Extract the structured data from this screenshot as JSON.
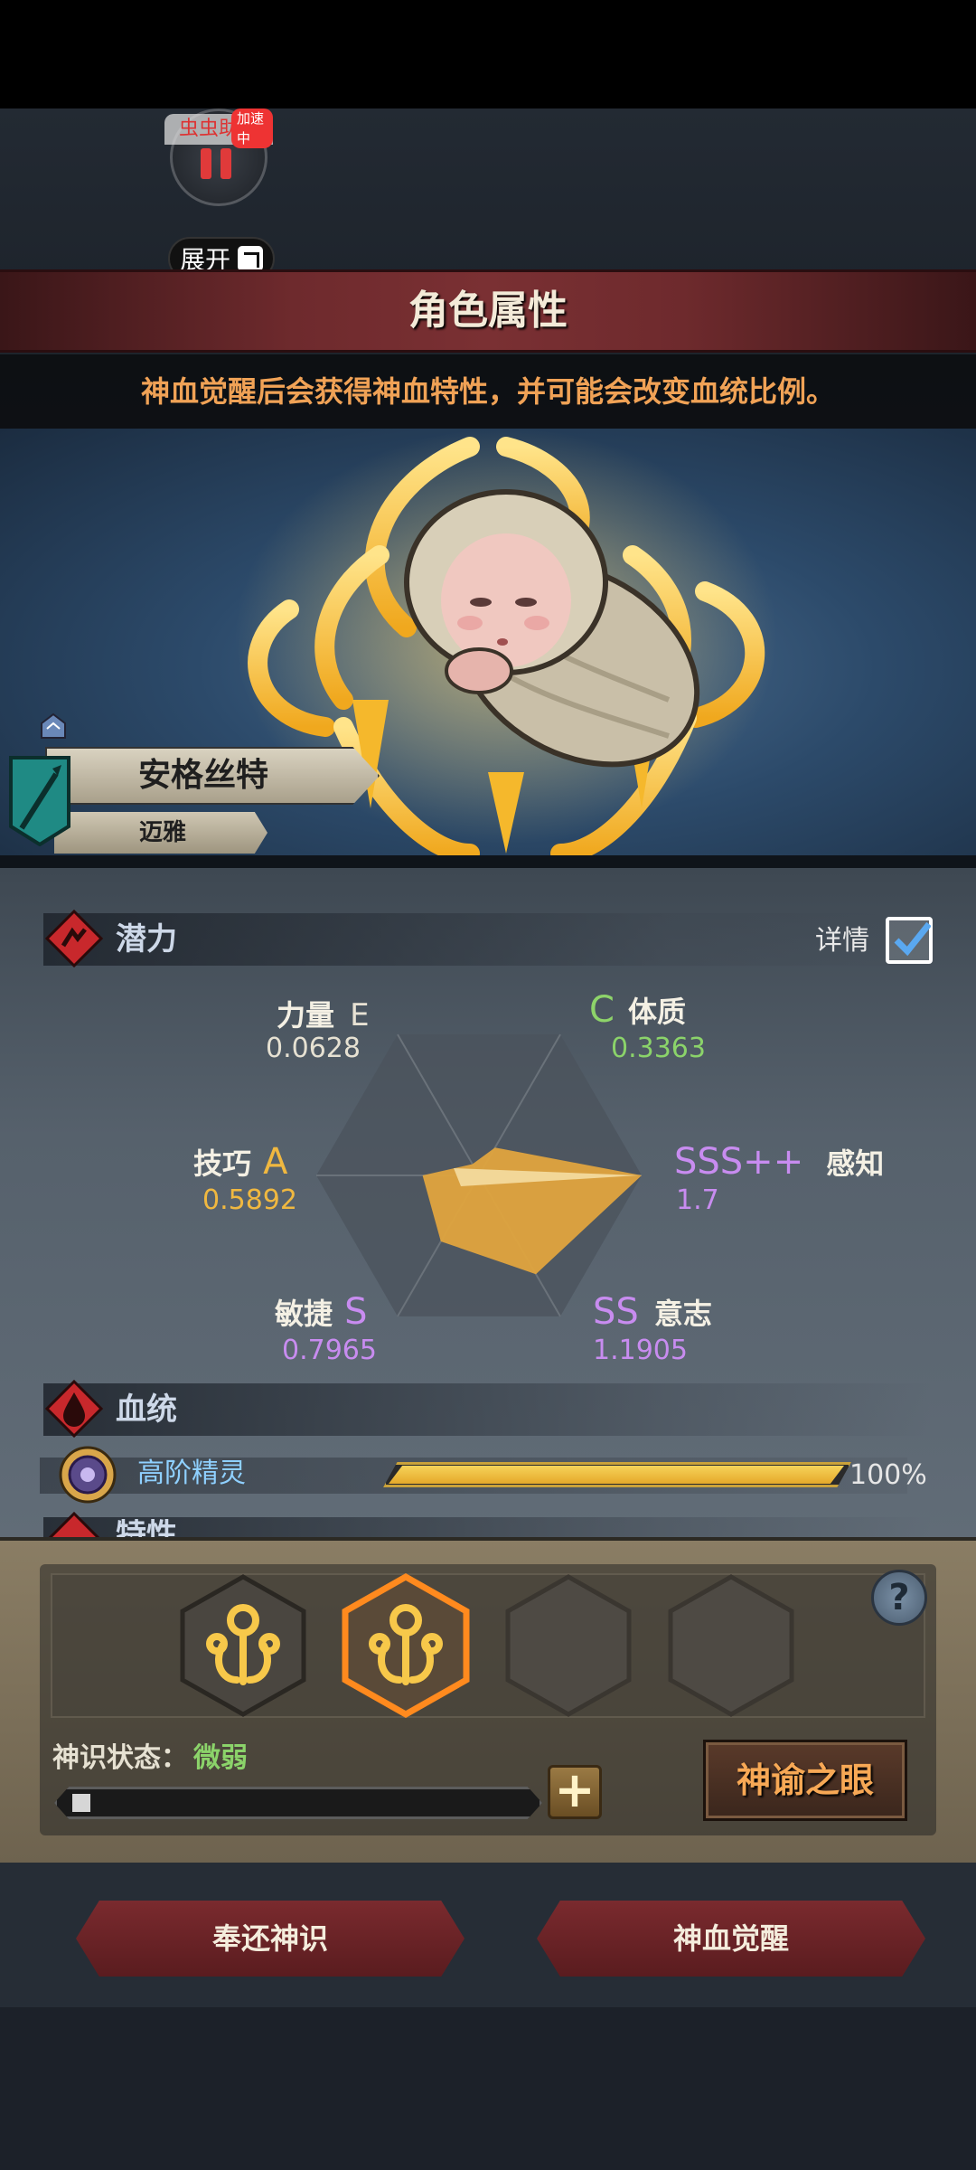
{
  "overlay": {
    "helper_label": "虫虫助手",
    "helper_badge": "加速中",
    "expand_label": "展开"
  },
  "header": {
    "title": "角色属性",
    "subtitle": "神血觉醒后会获得神血特性，并可能会改变血统比例。"
  },
  "hero": {
    "name": "安格丝特",
    "race": "迈雅"
  },
  "potential": {
    "section_title": "潜力",
    "detail_label": "详情",
    "detail_checked": true,
    "stats": [
      {
        "name": "力量",
        "grade": "E",
        "value": "0.0628"
      },
      {
        "name": "体质",
        "grade": "C",
        "value": "0.3363"
      },
      {
        "name": "感知",
        "grade": "SSS++",
        "value": "1.7"
      },
      {
        "name": "意志",
        "grade": "SS",
        "value": "1.1905"
      },
      {
        "name": "敏捷",
        "grade": "S",
        "value": "0.7965"
      },
      {
        "name": "技巧",
        "grade": "A",
        "value": "0.5892"
      }
    ]
  },
  "chart_data": {
    "type": "radar",
    "categories": [
      "力量",
      "体质",
      "感知",
      "意志",
      "敏捷",
      "技巧"
    ],
    "values": [
      0.0628,
      0.3363,
      1.7,
      1.1905,
      0.7965,
      0.5892
    ],
    "fill_color": "#e0a43e"
  },
  "bloodline": {
    "section_title": "血统",
    "name": "高阶精灵",
    "percent_label": "100%",
    "fraction": 1.0
  },
  "traits": {
    "section_title": "特性"
  },
  "divine": {
    "slots": [
      {
        "state": "filled"
      },
      {
        "state": "selected"
      },
      {
        "state": "empty"
      },
      {
        "state": "empty"
      }
    ],
    "help_label": "?",
    "awareness_label": "神识状态：",
    "awareness_state": "微弱",
    "awareness_fraction": 0.04,
    "plus_label": "+",
    "oracle_label": "神谕之眼"
  },
  "actions": {
    "return_label": "奉还神识",
    "awaken_label": "神血觉醒"
  },
  "colors": {
    "accent_gold": "#f0b840",
    "title_red": "#6e2a2d",
    "green": "#8bd36a",
    "purple": "#c88cf0"
  }
}
